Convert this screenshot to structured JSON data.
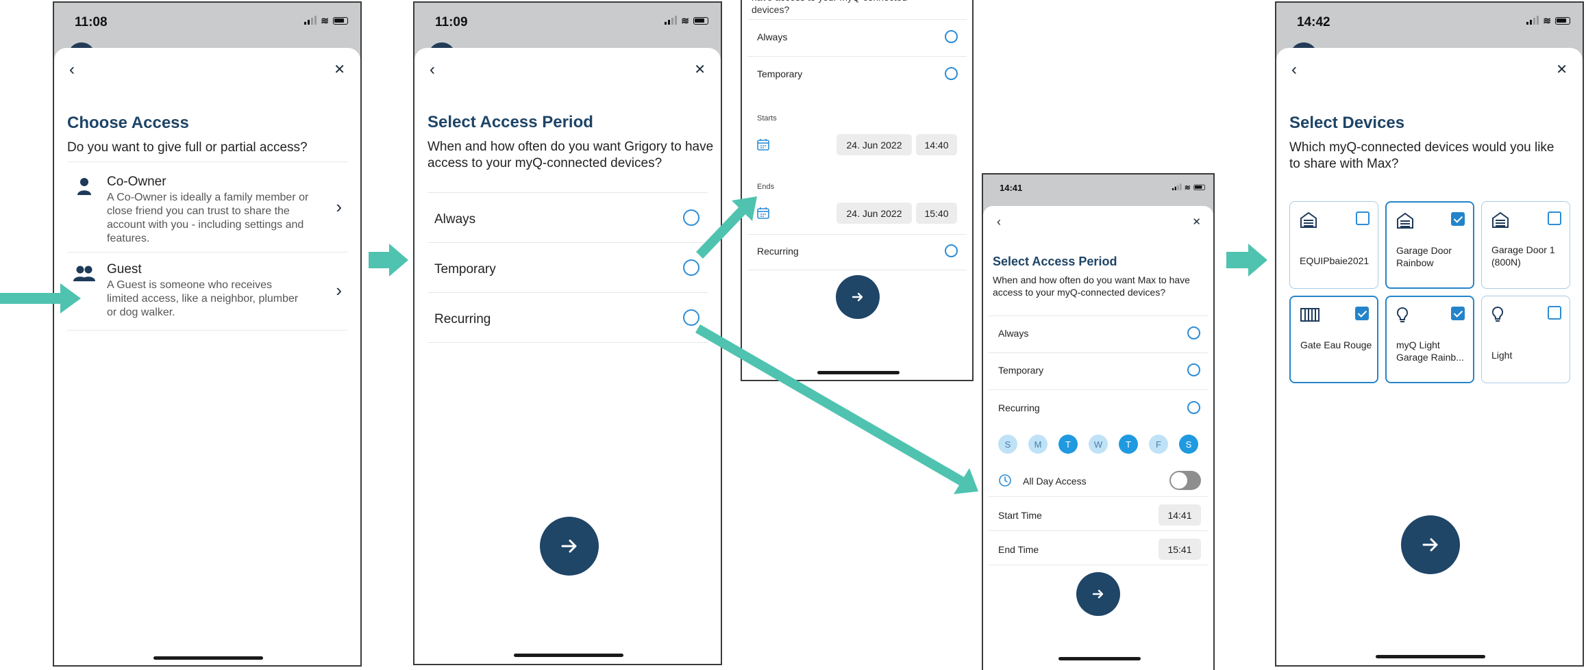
{
  "colors": {
    "brand_navy": "#1e4466",
    "accent_blue": "#2b8cd6",
    "teal_arrow": "#4fc3b0",
    "frame_gray": "#c9cbcc"
  },
  "screen1": {
    "time": "11:08",
    "title": "Choose Access",
    "subtitle": "Do you want to give full or partial access?",
    "options": [
      {
        "label": "Co-Owner",
        "desc": "A Co-Owner is ideally a family member or close friend you can trust to share the account with you - including settings and features.",
        "icon": "person-icon"
      },
      {
        "label": "Guest",
        "desc": "A Guest is someone who receives limited access, like a neighbor, plumber or dog walker.",
        "icon": "people-icon"
      }
    ]
  },
  "screen2": {
    "time": "11:09",
    "title": "Select Access Period",
    "subtitle": "When and how often do you want Grigory to have access to your myQ-connected devices?",
    "options": [
      "Always",
      "Temporary",
      "Recurring"
    ],
    "selected": "Always"
  },
  "screen3": {
    "top_text_fragment": "have access to your myQ-connected devices?",
    "options": [
      "Always",
      "Temporary"
    ],
    "selected": "Temporary",
    "starts_label": "Starts",
    "starts_date": "24. Jun 2022",
    "starts_time": "14:40",
    "ends_label": "Ends",
    "ends_date": "24. Jun 2022",
    "ends_time": "15:40",
    "recurring_label": "Recurring"
  },
  "screen4": {
    "time": "14:41",
    "title": "Select Access Period",
    "subtitle": "When and how often do you want Max to have access to your myQ-connected devices?",
    "options": [
      "Always",
      "Temporary",
      "Recurring"
    ],
    "selected": "Recurring",
    "days": [
      {
        "letter": "S",
        "on": false
      },
      {
        "letter": "M",
        "on": false
      },
      {
        "letter": "T",
        "on": true
      },
      {
        "letter": "W",
        "on": false
      },
      {
        "letter": "T",
        "on": true
      },
      {
        "letter": "F",
        "on": false
      },
      {
        "letter": "S",
        "on": true
      }
    ],
    "all_day_label": "All Day Access",
    "all_day_on": false,
    "start_time_label": "Start Time",
    "start_time": "14:41",
    "end_time_label": "End Time",
    "end_time": "15:41"
  },
  "screen5": {
    "time": "14:42",
    "title": "Select Devices",
    "subtitle": "Which myQ-connected devices would you like to share with Max?",
    "devices": [
      {
        "label": "EQUIPbaie2021",
        "icon": "garage-icon",
        "checked": false
      },
      {
        "label": "Garage Door Rainbow",
        "icon": "garage-icon",
        "checked": true
      },
      {
        "label": "Garage Door 1 (800N)",
        "icon": "garage-icon",
        "checked": false
      },
      {
        "label": "Gate Eau Rouge",
        "icon": "gate-icon",
        "checked": true
      },
      {
        "label": "myQ Light Garage Rainb...",
        "icon": "lightbulb-icon",
        "checked": true
      },
      {
        "label": "Light",
        "icon": "lightbulb-icon",
        "checked": false
      }
    ]
  }
}
